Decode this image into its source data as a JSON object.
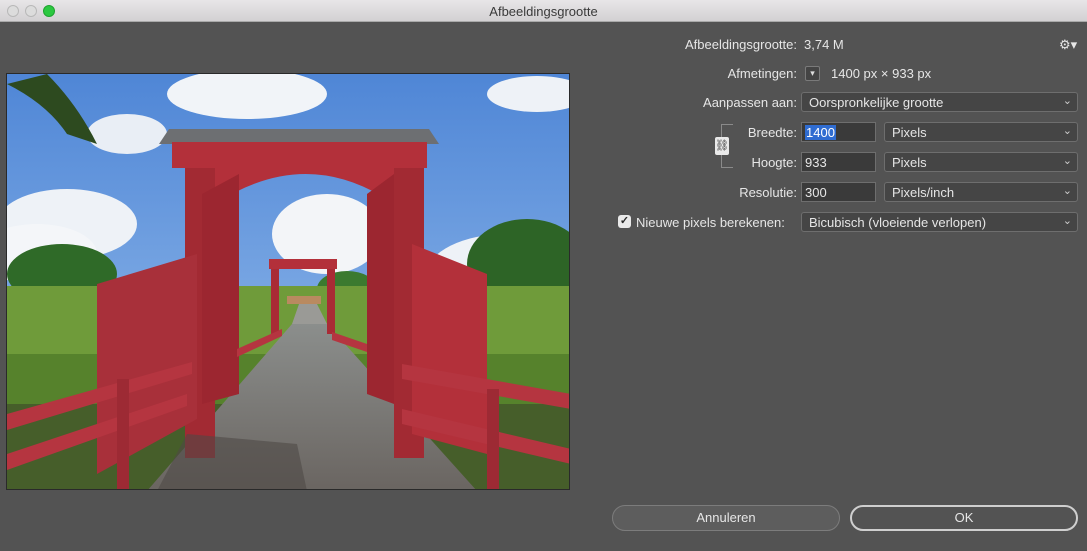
{
  "window": {
    "title": "Afbeeldingsgrootte"
  },
  "info": {
    "size_label": "Afbeeldingsgrootte:",
    "size_value": "3,74 M",
    "dimensions_label": "Afmetingen:",
    "dimensions_width": "1400 px",
    "dimensions_times": "×",
    "dimensions_height": "933 px"
  },
  "fit": {
    "label": "Aanpassen aan:",
    "value": "Oorspronkelijke grootte"
  },
  "width": {
    "label": "Breedte:",
    "value": "1400",
    "unit": "Pixels"
  },
  "height": {
    "label": "Hoogte:",
    "value": "933",
    "unit": "Pixels"
  },
  "resolution": {
    "label": "Resolutie:",
    "value": "300",
    "unit": "Pixels/inch"
  },
  "resample": {
    "label": "Nieuwe pixels berekenen:",
    "checked": true,
    "method": "Bicubisch (vloeiende verlopen)"
  },
  "buttons": {
    "cancel": "Annuleren",
    "ok": "OK"
  },
  "icons": {
    "gear": "gear-icon",
    "chain": "chain-link-icon",
    "chevron": "chevron-down-icon"
  },
  "colors": {
    "dialog_bg": "#535353",
    "accent": "#2f6cd1",
    "bridge_red": "#b3303a"
  }
}
